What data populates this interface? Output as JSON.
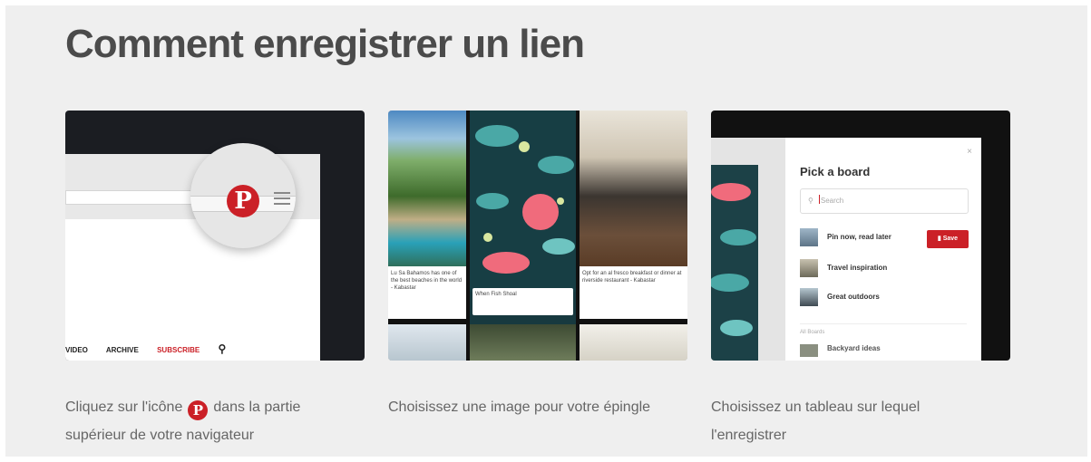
{
  "page": {
    "title": "Comment enregistrer un lien"
  },
  "step1": {
    "caption_before": "Cliquez sur l'icône",
    "caption_after": "dans la partie supérieur de votre navigateur",
    "pin_glyph": "P",
    "nav": {
      "video": "VIDEO",
      "archive": "ARCHIVE",
      "subscribe": "SUBSCRIBE",
      "search_glyph": "⚲"
    }
  },
  "step2": {
    "caption": "Choisissez une image pour votre épingle",
    "pin_texts": [
      "Lu Sa Bahamos has one of the best beaches in the world - Kabastar",
      "When Fish Shoal",
      "Opt for an al fresco breakfast or dinner at riverside restaurant - Kabastar"
    ]
  },
  "step3": {
    "caption": "Choisissez un tableau sur lequel l'enregistrer",
    "modal_title": "Pick a board",
    "close_glyph": "×",
    "search_placeholder": "Search",
    "search_glyph": "⚲",
    "boards": [
      "Pin now, read later",
      "Travel inspiration",
      "Great outdoors"
    ],
    "save_label": "Save",
    "save_glyph": "▮",
    "all_boards_label": "All Boards",
    "partial_board": "Backyard ideas"
  },
  "colors": {
    "pinterest_red": "#cb2027",
    "title": "#4b4b4b",
    "background": "#efefef"
  }
}
